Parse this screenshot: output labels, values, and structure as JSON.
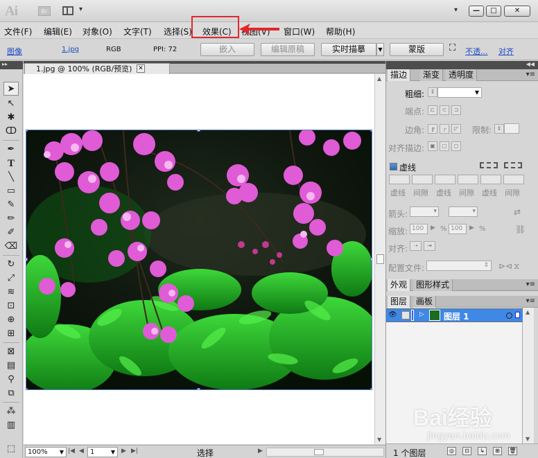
{
  "app": {
    "logo": "Ai",
    "bridge_logo": "Br",
    "window_controls": [
      "▾",
      "—",
      "□",
      "✕"
    ]
  },
  "menubar": {
    "items": [
      "文件(F)",
      "编辑(E)",
      "对象(O)",
      "文字(T)",
      "选择(S)",
      "效果(C)",
      "视图(V)",
      "窗口(W)",
      "帮助(H)"
    ],
    "highlighted": "效果(C)",
    "highlight_color": "#e3262d"
  },
  "control_bar": {
    "object_type": "图像",
    "file_link": "1.jpg",
    "color_mode": "RGB",
    "ppi": "PPI: 72",
    "embed": "嵌入",
    "edit_original": "编辑原稿",
    "live_trace": "实时描摹",
    "mask": "蒙版",
    "opacity": "不透...",
    "align": "对齐"
  },
  "document": {
    "tab_title": "1.jpg @ 100% (RGB/预览)",
    "close_symbol": "✕"
  },
  "statusbar": {
    "zoom": "100%",
    "page": "1",
    "tool_label": "选择"
  },
  "stroke_panel": {
    "tabs": [
      "描边",
      "渐变",
      "透明度"
    ],
    "weight_label": "粗细:",
    "cap_label": "端点:",
    "corner_label": "边角:",
    "limit_label": "限制:",
    "align_label": "对齐描边:",
    "dashed_label": "虚线",
    "dash_labels": [
      "虚线",
      "间隙",
      "虚线",
      "间隙",
      "虚线",
      "间隙"
    ],
    "arrow_label": "箭头:",
    "scale_label": "缩放:",
    "scale_values": [
      "100",
      "100"
    ],
    "percent": "%",
    "align2_label": "对齐:",
    "profile_label": "配置文件:"
  },
  "appearance_panel": {
    "tabs": [
      "外观",
      "图形样式"
    ]
  },
  "layers_panel": {
    "tabs": [
      "图层",
      "画板"
    ],
    "layers": [
      {
        "name": "图层 1"
      }
    ],
    "footer": "1 个图层"
  },
  "watermark": {
    "brand": "Bai经验",
    "url": "jingyan.baidu.com"
  }
}
